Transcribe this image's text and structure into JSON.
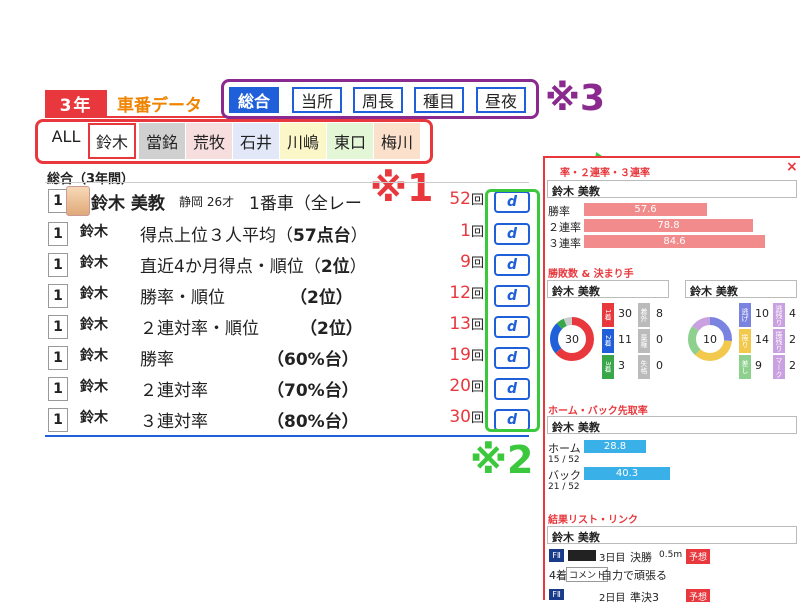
{
  "header": {
    "year_badge": "3年",
    "title": "車番データ"
  },
  "tabs": [
    {
      "label": "総合",
      "active": true
    },
    {
      "label": "当所",
      "active": false
    },
    {
      "label": "周長",
      "active": false
    },
    {
      "label": "種目",
      "active": false
    },
    {
      "label": "昼夜",
      "active": false
    }
  ],
  "filters": [
    {
      "label": "ALL",
      "bg": "#ffffff"
    },
    {
      "label": "鈴木",
      "bg": "#ffffff",
      "selected": true
    },
    {
      "label": "當銘",
      "bg": "#d0d0d0"
    },
    {
      "label": "荒牧",
      "bg": "#f6dede"
    },
    {
      "label": "石井",
      "bg": "#e2e8f8"
    },
    {
      "label": "川嶋",
      "bg": "#fbf7c9"
    },
    {
      "label": "東口",
      "bg": "#e3f6d5"
    },
    {
      "label": "梅川",
      "bg": "#fbe0cc"
    }
  ],
  "annotations": {
    "note1": "※1",
    "note2": "※2",
    "note3": "※3"
  },
  "list": {
    "section_label": "総合（3年間）",
    "first_row": {
      "num": "1",
      "name": "鈴木 美教",
      "meta": "静岡 26才",
      "desc": "1番車（全レー",
      "count": "52",
      "unit": "回",
      "btn": "d"
    },
    "rows": [
      {
        "num": "1",
        "name": "鈴木",
        "desc": "得点上位３人平均（",
        "value": "57点台",
        "tail": "）",
        "count": "1",
        "unit": "回",
        "btn": "d"
      },
      {
        "num": "1",
        "name": "鈴木",
        "desc": "直近4か月得点・順位（",
        "value": "2位",
        "tail": "）",
        "count": "9",
        "unit": "回",
        "btn": "d"
      },
      {
        "num": "1",
        "name": "鈴木",
        "desc": "勝率・順位",
        "value": "（2位）",
        "tail": "",
        "count": "12",
        "unit": "回",
        "btn": "d"
      },
      {
        "num": "1",
        "name": "鈴木",
        "desc": "２連対率・順位",
        "value": "（2位）",
        "tail": "",
        "count": "13",
        "unit": "回",
        "btn": "d"
      },
      {
        "num": "1",
        "name": "鈴木",
        "desc": "勝率",
        "value": "（60%台）",
        "tail": "",
        "count": "19",
        "unit": "回",
        "btn": "d"
      },
      {
        "num": "1",
        "name": "鈴木",
        "desc": "２連対率",
        "value": "（70%台）",
        "tail": "",
        "count": "20",
        "unit": "回",
        "btn": "d"
      },
      {
        "num": "1",
        "name": "鈴木",
        "desc": "３連対率",
        "value": "（80%台）",
        "tail": "",
        "count": "30",
        "unit": "回",
        "btn": "d"
      }
    ]
  },
  "panel": {
    "header": "率・２連率・３連率",
    "close": "×",
    "name": "鈴木 美教",
    "rates": [
      {
        "label": "勝率",
        "value": "57.6",
        "pct": 57.6
      },
      {
        "label": "２連率",
        "value": "78.8",
        "pct": 78.8
      },
      {
        "label": "３連率",
        "value": "84.6",
        "pct": 84.6
      }
    ],
    "wins_header": "勝敗数 & 決まり手",
    "left_chart": {
      "name": "鈴木 美教",
      "center": "30",
      "segs": [
        {
          "label": "1着",
          "value": "30",
          "color": "#e8383d"
        },
        {
          "label": "2着",
          "value": "11",
          "color": "#1f5fd9"
        },
        {
          "label": "3着",
          "value": "3",
          "color": "#3aa64a"
        }
      ],
      "right_segs": [
        {
          "label": "着外",
          "value": "8"
        },
        {
          "label": "棄権",
          "value": "0"
        },
        {
          "label": "失格",
          "value": "0"
        }
      ]
    },
    "right_chart": {
      "name": "鈴木 美教",
      "center": "10",
      "segs": [
        {
          "label": "逃げ",
          "value": "10",
          "color": "#7b83e0"
        },
        {
          "label": "捲り",
          "value": "14",
          "color": "#f2c94c"
        },
        {
          "label": "差し",
          "value": "9",
          "color": "#8ed18e"
        }
      ],
      "right_segs": [
        {
          "label": "逃残り",
          "value": "4"
        },
        {
          "label": "捲残り",
          "value": "2"
        },
        {
          "label": "マーク",
          "value": "2"
        }
      ]
    },
    "home_back_header": "ホーム・バック先取率",
    "hb_name": "鈴木 美教",
    "home": {
      "label": "ホーム",
      "value": "28.8",
      "sub": "15 / 52",
      "pct": 28.8
    },
    "back": {
      "label": "バック",
      "value": "40.3",
      "sub": "21 / 52",
      "pct": 40.3
    },
    "results_header": "結果リスト・リンク",
    "results_name": "鈴木 美教",
    "result1": {
      "grade": "FⅡ",
      "day": "3日目",
      "race": "決勝",
      "weather": "0.5m",
      "tag": "予想"
    },
    "result2": {
      "finish": "4着",
      "comment_label": "コメント",
      "comment": "自力で頑張る"
    },
    "result3": {
      "grade": "FⅡ",
      "day": "2日目",
      "race": "準決3",
      "tag": "予想"
    }
  }
}
